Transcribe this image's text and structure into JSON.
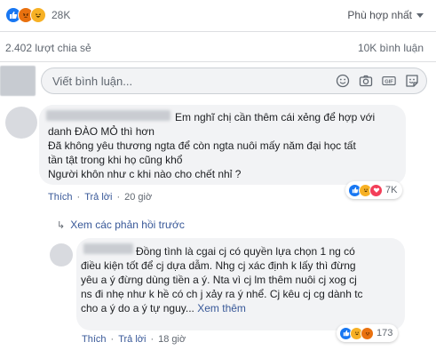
{
  "reactions_bar": {
    "count": "28K",
    "icons": [
      "like-icon",
      "angry-icon",
      "haha-icon"
    ],
    "sort_label": "Phù hợp nhất"
  },
  "stats": {
    "shares": "2.402 lượt chia sẻ",
    "comments": "10K bình luận"
  },
  "composer": {
    "placeholder": "Viết bình luận...",
    "tools": [
      "emoji-icon",
      "camera-icon",
      "gif-icon",
      "sticker-icon"
    ]
  },
  "comments": [
    {
      "text": "Em nghĩ chị cần thêm cái xẻng để hợp với\ndanh ĐÀO MỎ thì hơn\nĐã không yêu thương ngta để còn ngta nuôi mấy năm đại học tất\ntần tật trong khi họ cũng khổ\nNgười khôn như c khi nào cho chết nhỉ ?",
      "actions": {
        "like": "Thích",
        "reply": "Trả lời",
        "time": "20 giờ"
      },
      "reaction_count": "7K"
    },
    {
      "text": "Đồng tình là cgai cj có quyền lựa chọn 1 ng có\nđiều kiện tốt để cj dựa dẫm. Nhg cj xác định k lấy thì đừng\nyêu a ý đừng dùng tiền a ý. Nta vì cj lm thêm nuôi cj xog cj\nns đi nhẹ như k hề có ch j xảy ra ý nhể. Cj kêu cj cg dành tc\ncho a ý do a ý tự nguy...",
      "see_more": "Xem thêm",
      "actions": {
        "like": "Thích",
        "reply": "Trả lời",
        "time": "18 giờ"
      },
      "reaction_count": "173"
    }
  ],
  "view_previous_replies": "Xem các phản hồi trước",
  "colors": {
    "link": "#385898",
    "like": "#1877f2",
    "angry": "#e9710f",
    "haha": "#f7b125",
    "love": "#f33e58"
  }
}
